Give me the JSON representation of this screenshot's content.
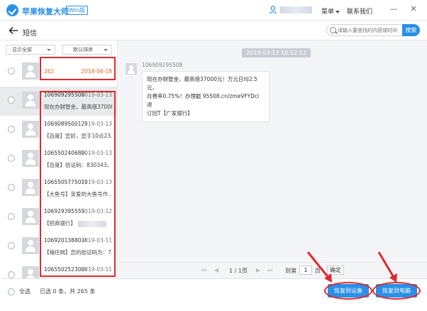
{
  "titlebar": {
    "app_title": "苹果恢复大师",
    "badge": "Win版",
    "menu_label": "菜单",
    "contact_label": "联系我们",
    "minimize": "—",
    "close": "✕"
  },
  "header": {
    "title": "短信",
    "search_placeholder": "请输入要查找的内容或时间",
    "search_button": "搜索"
  },
  "filters": {
    "show": "显示全部",
    "sort": "默认排序"
  },
  "messages": [
    {
      "number": "262",
      "date": "2018-06-18",
      "snippet": ""
    },
    {
      "number": "106909295508",
      "date": "2019-03-13",
      "snippet": "现在办财智金，最高借37000..."
    },
    {
      "number": "1069089500171...",
      "date": "2019-03-13",
      "snippet": "【百度】您好，您于10点23..."
    },
    {
      "number": "1065502406800...",
      "date": "2019-03-13",
      "snippet": "【百度】验证码：830343，..."
    },
    {
      "number": "1065505775011...",
      "date": "2019-03-13",
      "snippet": "【大鱼号】亲爱的大鱼号作..."
    },
    {
      "number": "106929395555",
      "date": "2019-03-12",
      "snippet": "【招商银行】"
    },
    {
      "number": "1069201388038...",
      "date": "2019-03-11",
      "snippet": "【嗨住网】您的验证码为：7..."
    },
    {
      "number": "1065502523008...",
      "date": "2019-03-11",
      "snippet": ""
    }
  ],
  "conversation": {
    "timestamp": "2019-03-13 18:12:12",
    "sender": "106909295508",
    "body_lines": [
      "现在办财智金，最高借37000元！万元日均2.5元，",
      "月费率0.75%！办理戳 95508.cn/zmeVFYDci 退",
      "订回T【广发银行】"
    ]
  },
  "pager": {
    "first": "⏮",
    "prev": "◀",
    "page_text": "1 / 1页",
    "next": "▶",
    "last": "⏭",
    "goto_prefix": "到第",
    "goto_value": "1",
    "goto_suffix": "页",
    "confirm": "确定"
  },
  "bottom": {
    "select_all": "全选",
    "selected_count": "已选 0 条，共 265 条",
    "btn_device": "恢复到设备",
    "btn_computer": "恢复到电脑"
  },
  "colors": {
    "accent": "#2a8fe6",
    "highlight": "#e0282e",
    "orange": "#e8641e"
  }
}
